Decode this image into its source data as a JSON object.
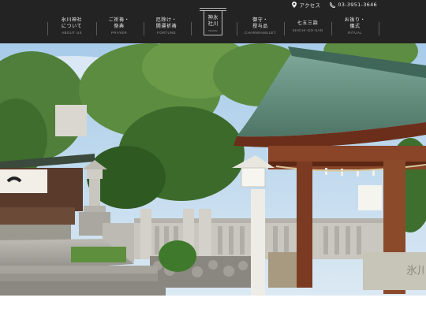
{
  "header": {
    "access_label": "アクセス",
    "phone": "03-3951-3646",
    "logo": {
      "text": "神氷\n社川",
      "sub": "HIKAWA"
    },
    "nav": [
      {
        "jp": "氷川神社\nについて",
        "en": "ABOUT US"
      },
      {
        "jp": "ご祈祷・\n祭典",
        "en": "PRAYER"
      },
      {
        "jp": "厄除け・\n開運祈祷",
        "en": "FORTUNE"
      },
      {
        "jp": "御守・\n授与品",
        "en": "CHARM/AMULET"
      },
      {
        "jp": "七五三詣",
        "en": "SHICHI-GO-SAN"
      },
      {
        "jp": "お祓り・\n儀式",
        "en": "RITUAL"
      }
    ]
  },
  "hero": {
    "image": "shrine-grounds-photo",
    "stone_inscription": "氷川"
  },
  "colors": {
    "header_bg": "#232323",
    "nav_text": "#f2f2f2",
    "nav_sub": "#9a9a9a",
    "roof_copper": "#5e8c7a",
    "wood": "#7a3b22",
    "sky": "#b9d6ee"
  }
}
